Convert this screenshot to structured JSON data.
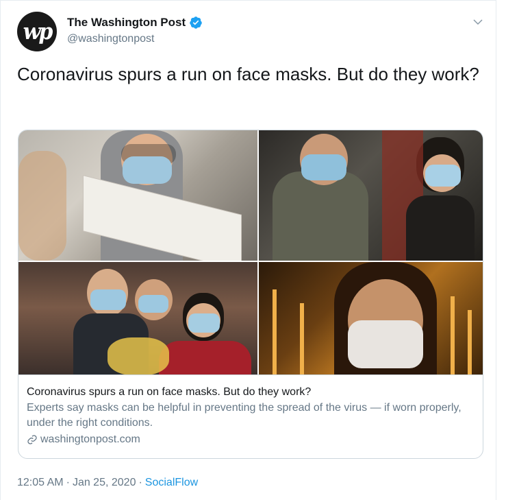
{
  "author": {
    "name": "The Washington Post",
    "handle": "@washingtonpost",
    "avatar_text": "wp"
  },
  "tweet": {
    "text": "Coronavirus spurs a run on face masks. But do they work?"
  },
  "card": {
    "title": "Coronavirus spurs a run on face masks. But do they work?",
    "description": "Experts say masks can be helpful in preventing the spread of the virus — if worn properly, under the right conditions.",
    "domain": "washingtonpost.com"
  },
  "meta": {
    "time": "12:05 AM",
    "separator1": "·",
    "date": "Jan 25, 2020",
    "separator2": "·",
    "source": "SocialFlow"
  },
  "colors": {
    "verified": "#1da1f2",
    "link": "#1b95e0",
    "secondary_text": "#657786"
  },
  "icons": {
    "verified": "verified-badge-icon",
    "caret": "chevron-down-icon",
    "link": "link-icon"
  }
}
